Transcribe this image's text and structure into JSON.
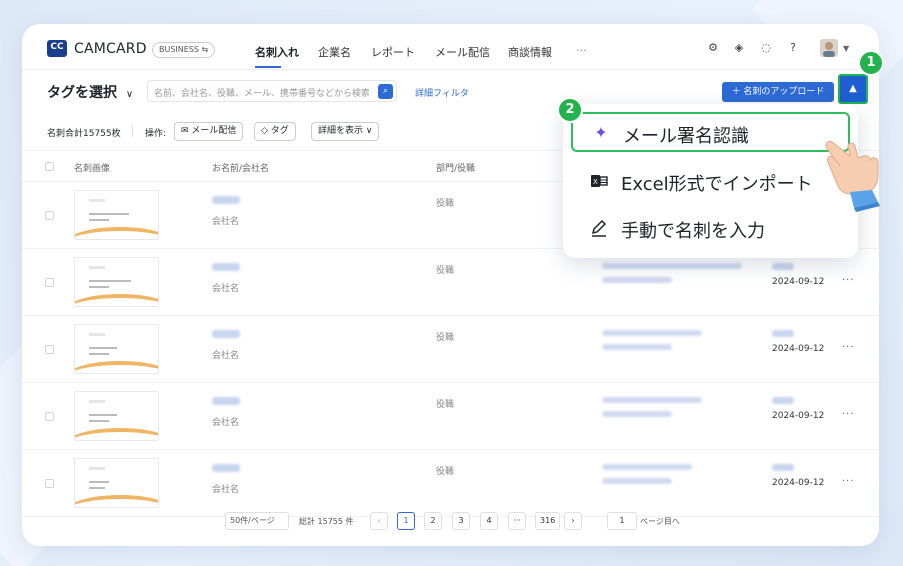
{
  "app": {
    "logo_text": "CC",
    "brand": "CAMCARD",
    "edition": "BUSINESS ⇆"
  },
  "nav": {
    "tabs": [
      "名刺入れ",
      "企業名",
      "レポート",
      "メール配信",
      "商談情報",
      "···"
    ],
    "active_index": 0
  },
  "header_icons": [
    "settings-icon",
    "layers-icon",
    "message-icon",
    "help-icon",
    "avatar"
  ],
  "toolbar": {
    "tag_select": "タグを選択",
    "search_placeholder": "名前、会社名、役職、メール、携帯番号などから検索",
    "detail_filter": "詳細フィルタ",
    "upload_button": "＋ 名刺のアップロード"
  },
  "actions": {
    "total": "名刺合計15755枚",
    "operation_label": "操作:",
    "mail_button": "✉ メール配信",
    "tag_button": "◇ タグ",
    "show_more_button": "詳細を表示 ∨"
  },
  "table": {
    "headers": [
      "名刺画像",
      "お名前/会社名",
      "部門/役職"
    ],
    "rows": [
      {
        "company": "会社名",
        "role": "役職",
        "date": ""
      },
      {
        "company": "会社名",
        "role": "役職",
        "date": "2024-09-12"
      },
      {
        "company": "会社名",
        "role": "役職",
        "date": "2024-09-12"
      },
      {
        "company": "会社名",
        "role": "役職",
        "date": "2024-09-12"
      },
      {
        "company": "会社名",
        "role": "役職",
        "date": "2024-09-12"
      }
    ]
  },
  "pagination": {
    "per_page": "50件/ページ",
    "total": "総計 15755 件",
    "pages": [
      "1",
      "2",
      "3",
      "4",
      "···",
      "316"
    ],
    "current": "1",
    "goto_value": "1",
    "goto_label": "ページ目へ"
  },
  "dropdown": {
    "items": [
      {
        "icon": "sparkle-icon",
        "label": "メール署名認識"
      },
      {
        "icon": "excel-icon",
        "label": "Excel形式でインポート"
      },
      {
        "icon": "pen-icon",
        "label": "手動で名刺を入力"
      }
    ]
  },
  "annotations": {
    "step1": "1",
    "step2": "2",
    "color": "#22b34c"
  }
}
